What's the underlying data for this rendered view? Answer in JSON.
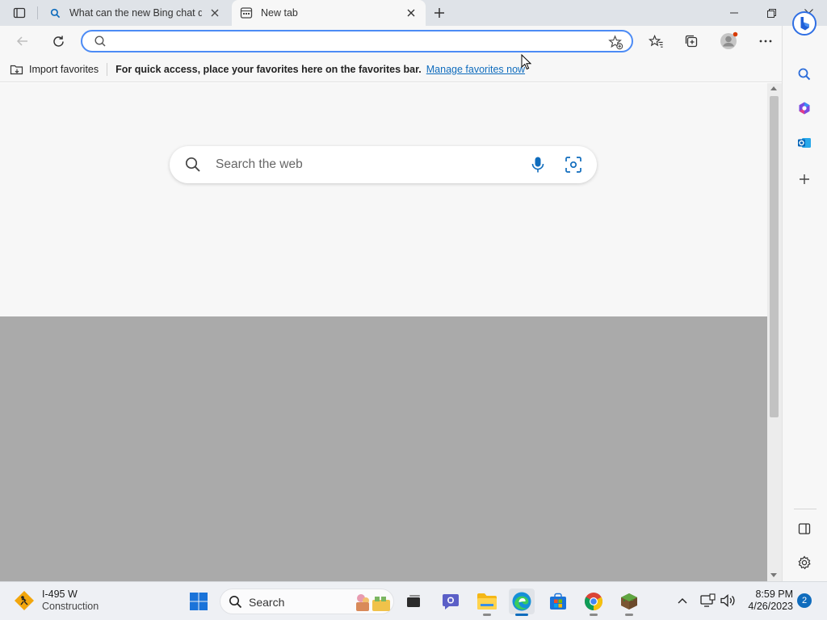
{
  "tabs": [
    {
      "title": "What can the new Bing chat do?",
      "active": false,
      "favicon": "search-icon"
    },
    {
      "title": "New tab",
      "active": true,
      "favicon": "new-tab-page-icon"
    }
  ],
  "address_bar": {
    "value": "",
    "placeholder": ""
  },
  "favorites_bar": {
    "import_label": "Import favorites",
    "hint": "For quick access, place your favorites here on the favorites bar.",
    "manage_link": "Manage favorites now"
  },
  "new_tab_page": {
    "search_placeholder": "Search the web"
  },
  "taskbar": {
    "weather_title": "I-495 W",
    "weather_sub": "Construction",
    "search_label": "Search",
    "time": "8:59 PM",
    "date": "4/26/2023",
    "notification_count": "2"
  },
  "colors": {
    "accent": "#0f6cbd",
    "omnibox_border": "#4c8bf5",
    "page_bg": "#f7f7f7",
    "overlay_gray": "#aaaaaa"
  }
}
